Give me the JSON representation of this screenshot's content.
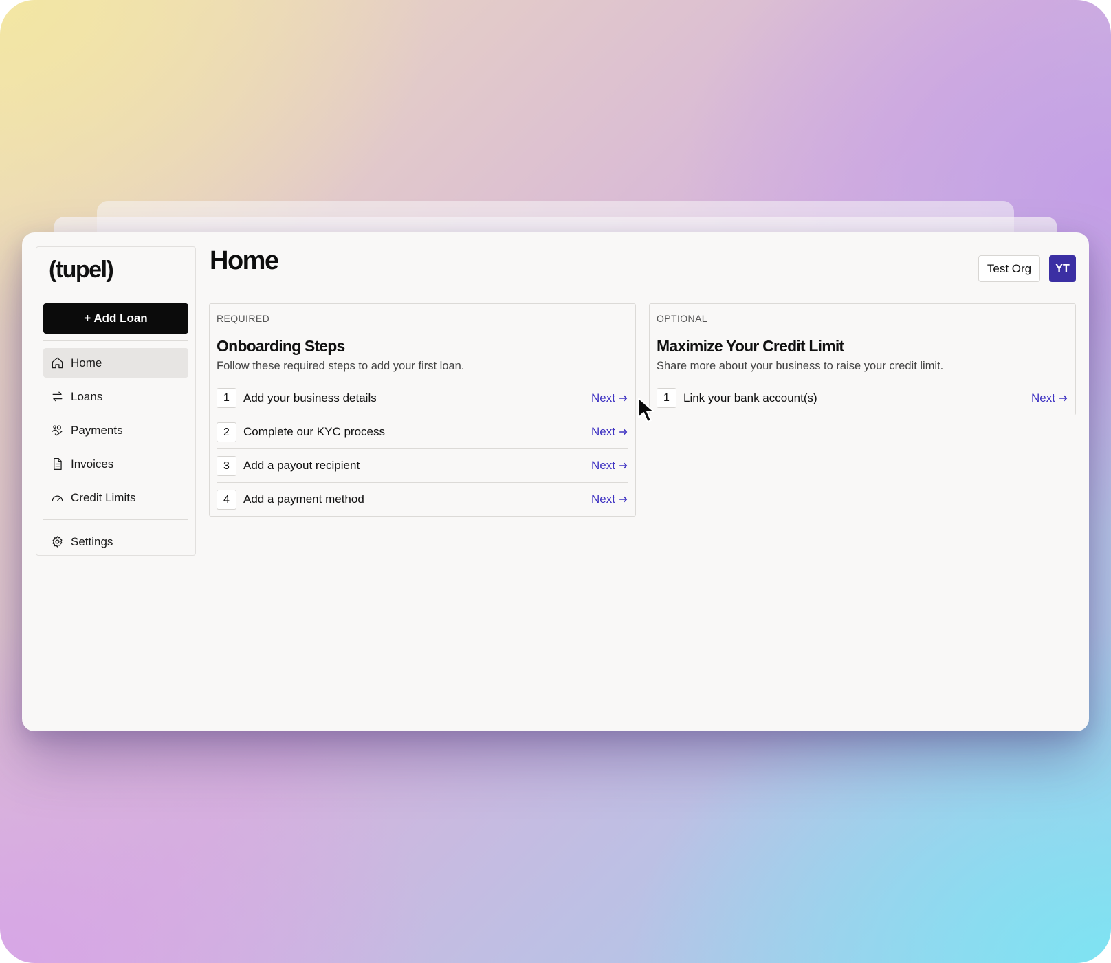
{
  "app": {
    "logo": "(tupel)"
  },
  "sidebar": {
    "add_loan": "+ Add Loan",
    "items": [
      {
        "label": "Home",
        "icon": "home-icon",
        "active": true
      },
      {
        "label": "Loans",
        "icon": "arrows-swap-icon",
        "active": false
      },
      {
        "label": "Payments",
        "icon": "payments-icon",
        "active": false
      },
      {
        "label": "Invoices",
        "icon": "document-icon",
        "active": false
      },
      {
        "label": "Credit Limits",
        "icon": "gauge-icon",
        "active": false
      }
    ],
    "settings": {
      "label": "Settings",
      "icon": "gear-icon"
    }
  },
  "header": {
    "title": "Home",
    "org": "Test Org",
    "avatar_initials": "YT",
    "avatar_color": "#3b2fa3"
  },
  "required_card": {
    "tag": "REQUIRED",
    "title": "Onboarding Steps",
    "subtitle": "Follow these required steps to add your first loan.",
    "steps": [
      {
        "num": "1",
        "label": "Add your business details",
        "action": "Next"
      },
      {
        "num": "2",
        "label": "Complete our KYC process",
        "action": "Next"
      },
      {
        "num": "3",
        "label": "Add a payout recipient",
        "action": "Next"
      },
      {
        "num": "4",
        "label": "Add a payment method",
        "action": "Next"
      }
    ]
  },
  "optional_card": {
    "tag": "OPTIONAL",
    "title": "Maximize Your Credit Limit",
    "subtitle": "Share more about your business to raise your credit limit.",
    "steps": [
      {
        "num": "1",
        "label": "Link your bank account(s)",
        "action": "Next"
      }
    ]
  },
  "colors": {
    "accent": "#3f33c2",
    "primary_button": "#0b0b0b"
  }
}
